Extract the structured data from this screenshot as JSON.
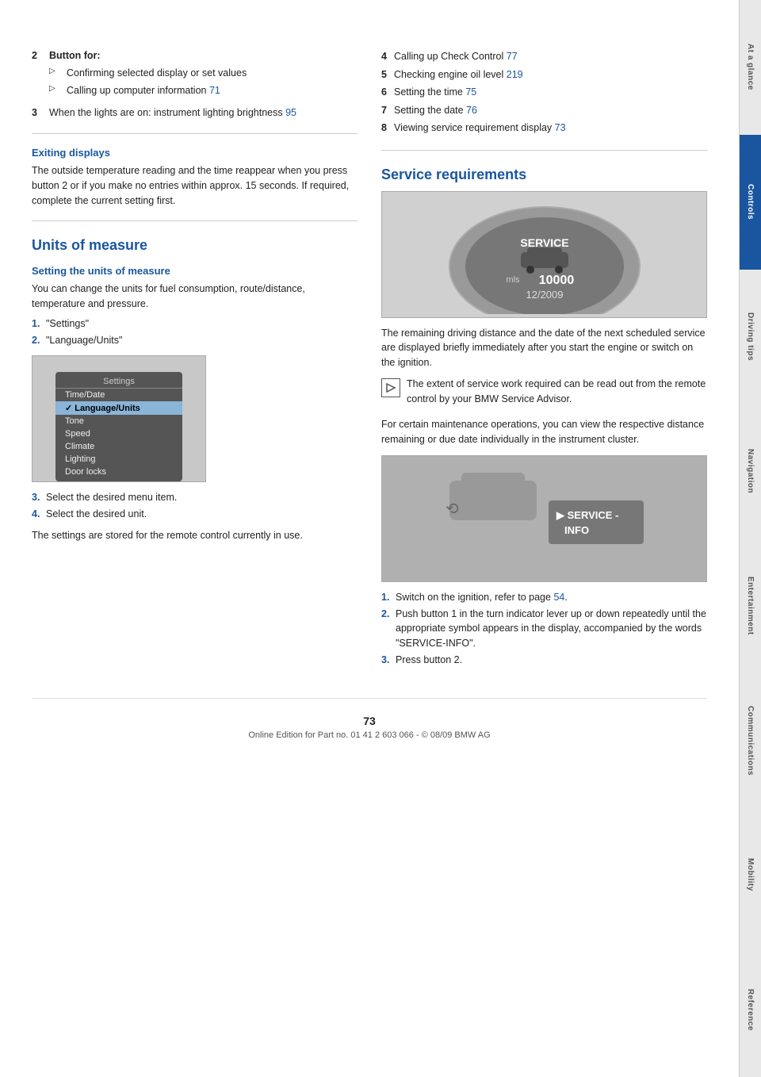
{
  "page": {
    "number": "73",
    "footer_text": "Online Edition for Part no. 01 41 2 603 066 - © 08/09 BMW AG"
  },
  "tabs": [
    {
      "id": "at-a-glance",
      "label": "At a glance",
      "active": false
    },
    {
      "id": "controls",
      "label": "Controls",
      "active": true
    },
    {
      "id": "driving-tips",
      "label": "Driving tips",
      "active": false
    },
    {
      "id": "navigation",
      "label": "Navigation",
      "active": false
    },
    {
      "id": "entertainment",
      "label": "Entertainment",
      "active": false
    },
    {
      "id": "communications",
      "label": "Communications",
      "active": false
    },
    {
      "id": "mobility",
      "label": "Mobility",
      "active": false
    },
    {
      "id": "reference",
      "label": "Reference",
      "active": false
    }
  ],
  "left_column": {
    "intro": {
      "item2_label": "2",
      "item2_text": "Button for:",
      "bullet1": "Confirming selected display or set values",
      "bullet2_prefix": "Calling up computer information",
      "bullet2_link": "71",
      "item3_label": "3",
      "item3_prefix": "When the lights are on: instrument lighting brightness",
      "item3_link": "95"
    },
    "exiting_displays": {
      "heading": "Exiting displays",
      "text": "The outside temperature reading and the time reappear when you press button 2 or if you make no entries within approx. 15 seconds. If required, complete the current setting first."
    },
    "units_of_measure": {
      "heading": "Units of measure",
      "subheading": "Setting the units of measure",
      "text": "You can change the units for fuel consumption, route/distance, temperature and pressure.",
      "step1": "\"Settings\"",
      "step2": "\"Language/Units\"",
      "settings_menu": {
        "title": "Settings",
        "items": [
          {
            "label": "Time/Date",
            "selected": false
          },
          {
            "label": "Language/Units",
            "selected": true
          },
          {
            "label": "Tone",
            "selected": false
          },
          {
            "label": "Speed",
            "selected": false
          },
          {
            "label": "Climate",
            "selected": false
          },
          {
            "label": "Lighting",
            "selected": false
          },
          {
            "label": "Door locks",
            "selected": false
          }
        ]
      },
      "step3": "Select the desired menu item.",
      "step4": "Select the desired unit.",
      "footer_text": "The settings are stored for the remote control currently in use."
    }
  },
  "right_column": {
    "intro_items": [
      {
        "num": "4",
        "text": "Calling up Check Control",
        "link": "77"
      },
      {
        "num": "5",
        "text": "Checking engine oil level",
        "link": "219"
      },
      {
        "num": "6",
        "text": "Setting the time",
        "link": "75"
      },
      {
        "num": "7",
        "text": "Setting the date",
        "link": "76"
      },
      {
        "num": "8",
        "text": "Viewing service requirement display",
        "link": "73"
      }
    ],
    "service_requirements": {
      "heading": "Service requirements",
      "service_display": {
        "label": "SERVICE",
        "mls": "mls",
        "miles": "10000",
        "date": "12/2009"
      },
      "text1": "The remaining driving distance and the date of the next scheduled service are displayed briefly immediately after you start the engine or switch on the ignition.",
      "note_text": "The extent of service work required can be read out from the remote control by your BMW Service Advisor.",
      "text2": "For certain maintenance operations, you can view the respective distance remaining or due date individually in the instrument cluster.",
      "service_info_text": "SERVICE - INFO",
      "steps": [
        {
          "num": "1.",
          "text": "Switch on the ignition, refer to page",
          "link": "54",
          "text_after": "."
        },
        {
          "num": "2.",
          "text": "Push button 1 in the turn indicator lever up or down repeatedly until the appropriate symbol appears in the display, accompanied by the words \"SERVICE-INFO\"."
        },
        {
          "num": "3.",
          "text": "Press button 2."
        }
      ]
    }
  }
}
